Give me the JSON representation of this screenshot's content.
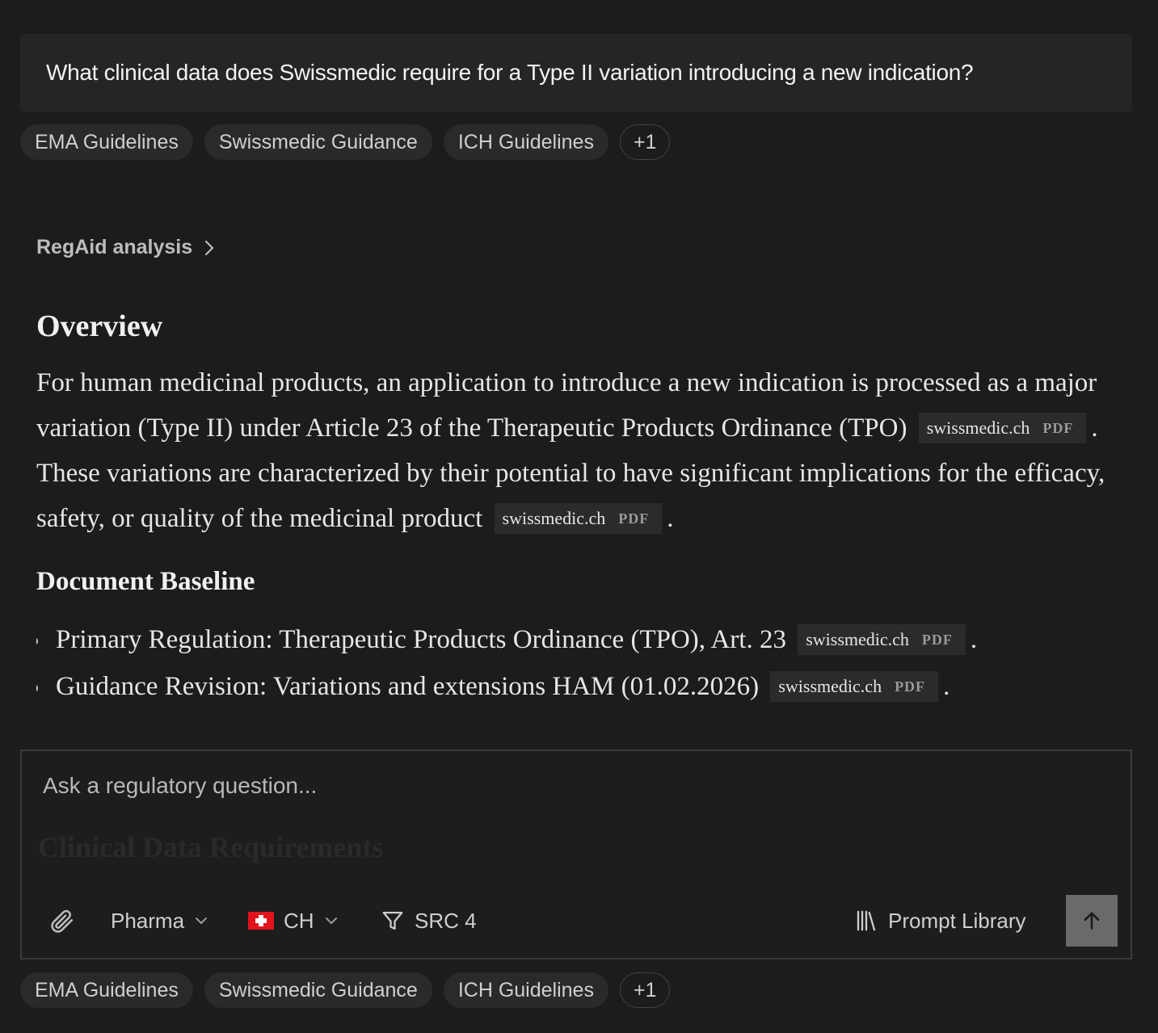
{
  "question": "What clinical data does Swissmedic require for a Type II variation introducing a new indication?",
  "source_chips": [
    "EMA Guidelines",
    "Swissmedic Guidance",
    "ICH Guidelines"
  ],
  "source_more": "+1",
  "analysis_toggle": "RegAid analysis",
  "answer": {
    "overview_heading": "Overview",
    "overview_text_1": "For human medicinal products, an application to introduce a new indication is processed as a major variation (Type II) under Article 23 of the Therapeutic Products Ordinance (TPO)",
    "overview_text_2": ". These variations are characterized by their potential to have significant implications for the efficacy, safety, or quality of the medicinal product",
    "overview_text_3": ".",
    "citation_source": "swissmedic.ch",
    "citation_type": "PDF",
    "baseline_heading": "Document Baseline",
    "bullet_1": "Primary Regulation: Therapeutic Products Ordinance (TPO), Art. 23",
    "bullet_2": "Guidance Revision: Variations and extensions HAM (01.02.2026)",
    "bullet_end": "."
  },
  "composer": {
    "placeholder": "Ask a regulatory question...",
    "faded_heading": "Clinical Data Requirements",
    "industry": "Pharma",
    "country": "CH",
    "sources": "SRC 4",
    "prompt_library": "Prompt Library"
  },
  "icons": {
    "attach": "paperclip-icon",
    "filter": "filter-icon",
    "library": "library-icon",
    "send": "arrow-up-icon",
    "chevron": "chevron-down-icon",
    "expand": "chevron-right-icon",
    "flag": "swiss-flag-icon"
  },
  "colors": {
    "background": "#1c1c1d",
    "card": "#252526",
    "send_button": "#6a6a6a",
    "flag_red": "#e3121b"
  }
}
